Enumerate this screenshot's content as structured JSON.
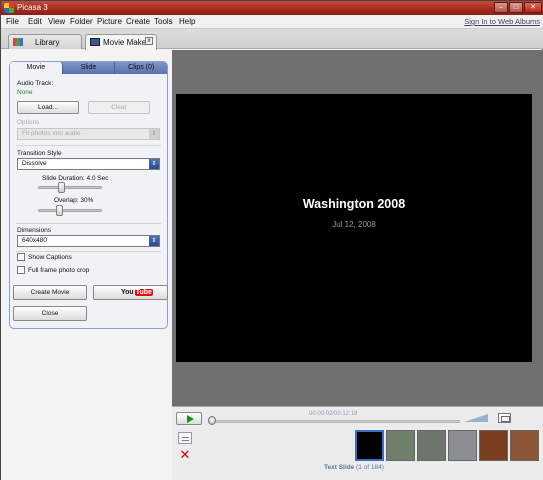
{
  "window": {
    "title": "Picasa 3",
    "controls": [
      "minimize",
      "maximize",
      "close"
    ]
  },
  "menu": {
    "items": [
      "File",
      "Edit",
      "View",
      "Folder",
      "Picture",
      "Create",
      "Tools",
      "Help"
    ],
    "signin": "Sign In to Web Albums"
  },
  "tabs": [
    {
      "label": "Library",
      "icon": "library-icon"
    },
    {
      "label": "Movie Maker",
      "icon": "movie-maker-icon",
      "close": "x"
    }
  ],
  "panel": {
    "tabs": [
      "Movie",
      "Slide",
      "Clips (0)"
    ],
    "audio_label": "Audio Track:",
    "audio_value": "None",
    "load_label": "Load...",
    "clear_label": "Clear",
    "options_label": "Options",
    "options_value": "Fit photos into audio",
    "transition_label": "Transition Style",
    "transition_value": "Dissolve",
    "duration_label": "Slide Duration: 4.0 Sec",
    "duration_value": 4.0,
    "overlap_label": "Overlap: 30%",
    "overlap_value": 30,
    "dimensions_label": "Dimensions",
    "dimensions_value": "640x480",
    "show_captions_label": "Show Captions",
    "show_captions_checked": false,
    "fullframe_label": "Full frame photo crop",
    "fullframe_checked": false
  },
  "actions": {
    "create_movie": "Create Movie",
    "youtube_you": "You",
    "youtube_tube": "Tube",
    "close": "Close"
  },
  "preview": {
    "title": "Washington 2008",
    "date": "Jul 12, 2008"
  },
  "playback": {
    "time": "00:00:02/00:12:18",
    "progress": 0.003
  },
  "filmstrip": {
    "label_bold": "Text Slide",
    "label_count": "(1 of 184)",
    "thumbs": [
      {
        "name": "text-slide",
        "color": "#000000",
        "selected": true
      },
      {
        "name": "photo-2",
        "color": "#6f7f6a",
        "selected": false
      },
      {
        "name": "photo-3",
        "color": "#6e776c",
        "selected": false
      },
      {
        "name": "photo-4",
        "color": "#8b8e93",
        "selected": false
      },
      {
        "name": "photo-5",
        "color": "#7a3e1e",
        "selected": false
      },
      {
        "name": "photo-6",
        "color": "#8c5535",
        "selected": false
      }
    ]
  }
}
